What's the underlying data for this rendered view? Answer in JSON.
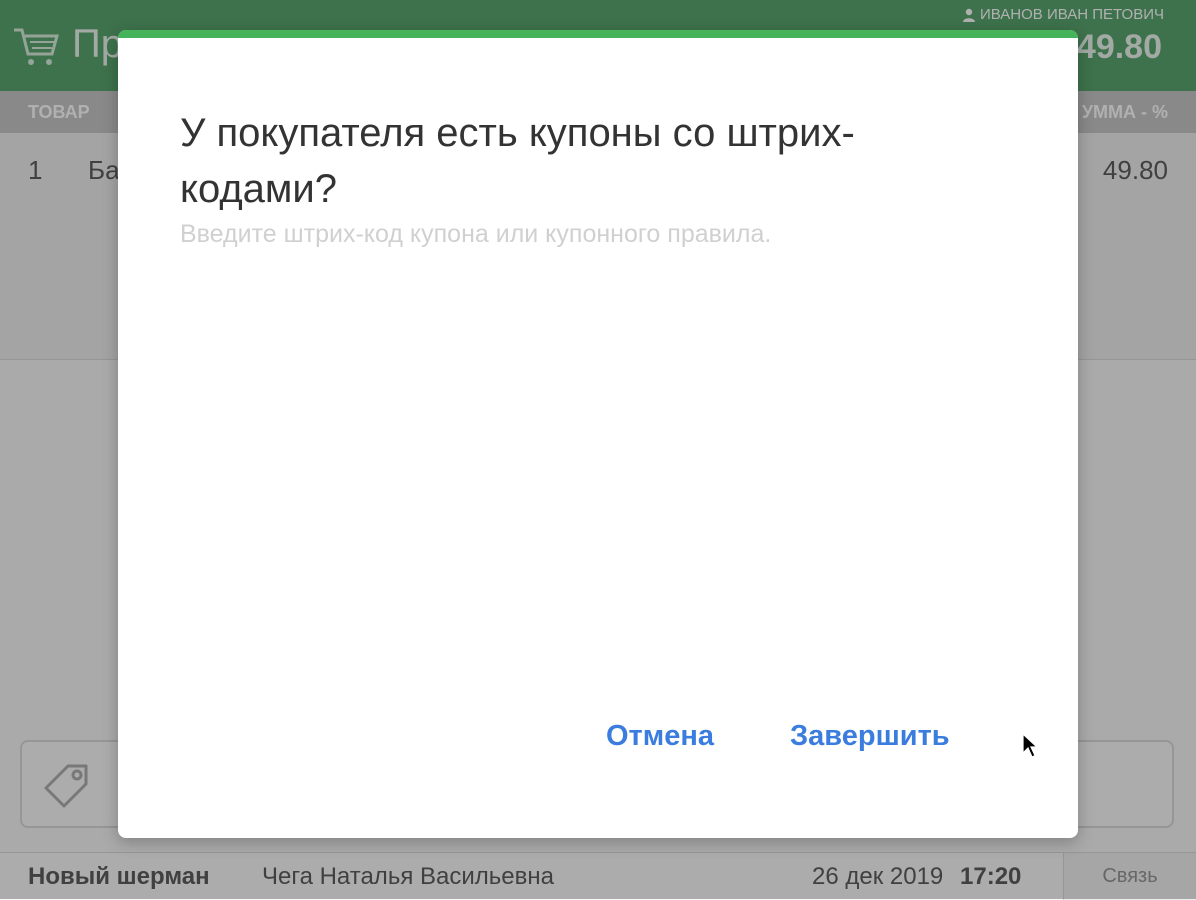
{
  "header": {
    "title": "Пр",
    "user_name": "ИВАНОВ ИВАН ПЕТОВИЧ",
    "total": "49.80",
    "icons": [
      "cart-icon",
      "user-icon"
    ]
  },
  "table": {
    "col_goods": "ТОВАР",
    "col_sum": "УММА - %",
    "rows": [
      {
        "num": "1",
        "name": "Ба",
        "sum": "49.80"
      }
    ]
  },
  "coupon_area": {
    "icon": "tag-icon"
  },
  "footer": {
    "store": "Новый шерман",
    "cashier": "Чега Наталья Васильевна",
    "date": "26 дек 2019",
    "time": "17:20",
    "link": "Связь"
  },
  "dialog": {
    "title": "У покупателя есть купоны со штрих-кодами?",
    "hint": "Введите штрих-код купона или купонного правила.",
    "input_value": "",
    "cancel_label": "Отмена",
    "finish_label": "Завершить",
    "accent_color": "#45b35a",
    "button_color": "#3b7dde"
  },
  "colors": {
    "header_bg": "#2e8f4a",
    "column_header_bg": "#b9b9b9"
  }
}
